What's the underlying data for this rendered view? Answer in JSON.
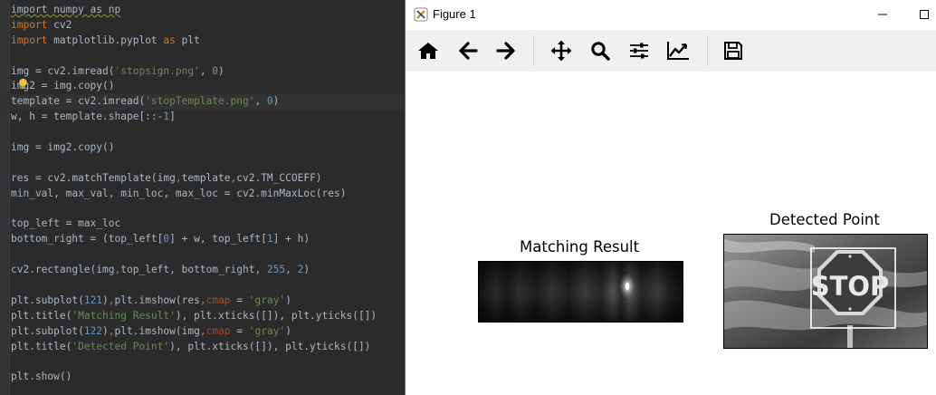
{
  "editor": {
    "lines": [
      [
        {
          "t": "import numpy as np",
          "c": "warn"
        }
      ],
      [
        {
          "t": "import",
          "c": "kw"
        },
        {
          "t": " cv2"
        }
      ],
      [
        {
          "t": "import",
          "c": "kw"
        },
        {
          "t": " matplotlib.pyplot "
        },
        {
          "t": "as",
          "c": "kw"
        },
        {
          "t": " plt"
        }
      ],
      [
        {
          "t": ""
        }
      ],
      [
        {
          "t": "img = cv2.imread("
        },
        {
          "t": "'stopsign.png'",
          "c": "str"
        },
        {
          "t": ", "
        },
        {
          "t": "0",
          "c": "num"
        },
        {
          "t": ")"
        }
      ],
      [
        {
          "t": "img2 = img.copy()"
        }
      ],
      [
        {
          "t": "template = cv2.imread("
        },
        {
          "t": "'stopTemplate.png'",
          "c": "str"
        },
        {
          "t": ", "
        },
        {
          "t": "0",
          "c": "num"
        },
        {
          "t": ")"
        }
      ],
      [
        {
          "t": "w, h = template.shape[::-"
        },
        {
          "t": "1",
          "c": "num"
        },
        {
          "t": "]"
        }
      ],
      [
        {
          "t": ""
        }
      ],
      [
        {
          "t": "img = img2.copy()"
        }
      ],
      [
        {
          "t": ""
        }
      ],
      [
        {
          "t": "res = cv2.matchTemplate(img"
        },
        {
          "t": ",",
          "c": "kw"
        },
        {
          "t": "template"
        },
        {
          "t": ",",
          "c": "kw"
        },
        {
          "t": "cv2.TM_CCOEFF)"
        }
      ],
      [
        {
          "t": "min_val, max_val, min_loc, max_loc = cv2.minMaxLoc(res)"
        }
      ],
      [
        {
          "t": ""
        }
      ],
      [
        {
          "t": "top_left = max_loc"
        }
      ],
      [
        {
          "t": "bottom_right = (top_left["
        },
        {
          "t": "0",
          "c": "num"
        },
        {
          "t": "] + w, top_left["
        },
        {
          "t": "1",
          "c": "num"
        },
        {
          "t": "] + h)"
        }
      ],
      [
        {
          "t": ""
        }
      ],
      [
        {
          "t": "cv2.rectangle(img"
        },
        {
          "t": ",",
          "c": "kw"
        },
        {
          "t": "top_left, bottom_right, "
        },
        {
          "t": "255",
          "c": "num"
        },
        {
          "t": ", "
        },
        {
          "t": "2",
          "c": "num"
        },
        {
          "t": ")"
        }
      ],
      [
        {
          "t": ""
        }
      ],
      [
        {
          "t": "plt.subplot("
        },
        {
          "t": "121",
          "c": "num"
        },
        {
          "t": ")"
        },
        {
          "t": ",",
          "c": "kw"
        },
        {
          "t": "plt.imshow(res"
        },
        {
          "t": ",",
          "c": "kw"
        },
        {
          "t": "cmap",
          "c": "arg"
        },
        {
          "t": " = "
        },
        {
          "t": "'gray'",
          "c": "str"
        },
        {
          "t": ")"
        }
      ],
      [
        {
          "t": "plt.title("
        },
        {
          "t": "'Matching Result'",
          "c": "str"
        },
        {
          "t": "), plt.xticks([]), plt.yticks([])"
        }
      ],
      [
        {
          "t": "plt.subplot("
        },
        {
          "t": "122",
          "c": "num"
        },
        {
          "t": ")"
        },
        {
          "t": ",",
          "c": "kw"
        },
        {
          "t": "plt.imshow(img"
        },
        {
          "t": ",",
          "c": "kw"
        },
        {
          "t": "cmap",
          "c": "arg"
        },
        {
          "t": " = "
        },
        {
          "t": "'gray'",
          "c": "str"
        },
        {
          "t": ")"
        }
      ],
      [
        {
          "t": "plt.title("
        },
        {
          "t": "'Detected Point'",
          "c": "str"
        },
        {
          "t": "), plt.xticks([]), plt.yticks([])"
        }
      ],
      [
        {
          "t": ""
        }
      ],
      [
        {
          "t": "plt.show()"
        }
      ]
    ],
    "current_line": 6
  },
  "figure": {
    "title": "Figure 1",
    "toolbar": [
      {
        "icon": "home-icon"
      },
      {
        "icon": "back-arrow-icon"
      },
      {
        "icon": "forward-arrow-icon"
      },
      {
        "icon": "pan-move-icon"
      },
      {
        "icon": "zoom-magnifier-icon"
      },
      {
        "icon": "configure-subplots-icon"
      },
      {
        "icon": "edit-axes-icon"
      },
      {
        "icon": "save-disk-icon"
      }
    ],
    "plots": [
      {
        "title": "Matching Result"
      },
      {
        "title": "Detected Point"
      }
    ],
    "stop_text": "STOP"
  },
  "colors": {
    "keyword": "#cc7832",
    "string": "#6a8759",
    "number": "#6897bb",
    "editor_bg": "#2b2b2b",
    "window_border": "#c24b3c"
  }
}
